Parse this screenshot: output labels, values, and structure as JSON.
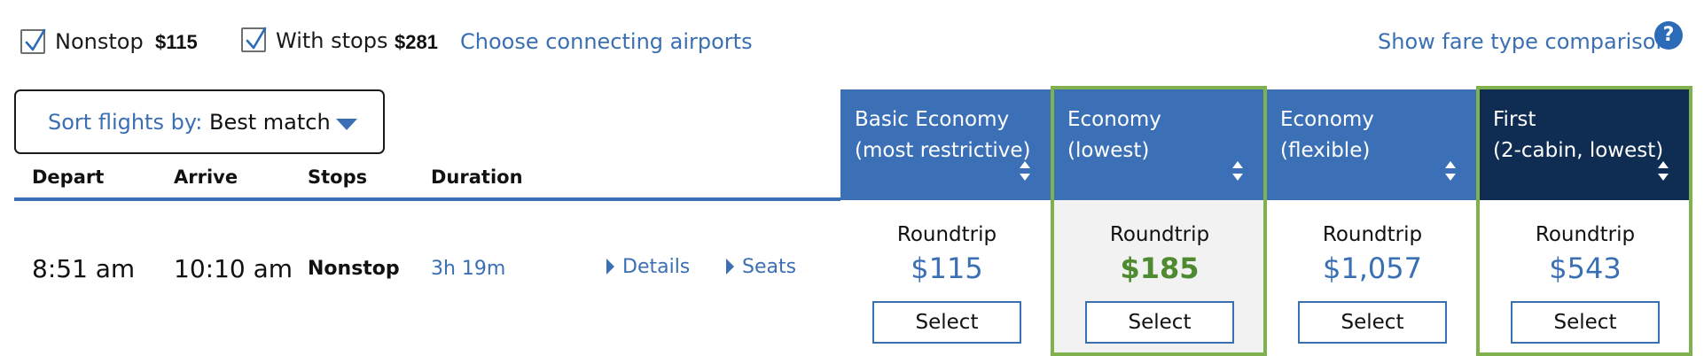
{
  "filters": {
    "nonstop": {
      "label": "Nonstop",
      "price": "$115",
      "checked": true
    },
    "with_stops": {
      "label": "With stops",
      "price": "$281",
      "checked": true
    },
    "connecting_link": "Choose connecting airports",
    "fare_comparison_link": "Show fare type comparison",
    "help_icon": "?"
  },
  "sort": {
    "prefix": "Sort flights by:",
    "value": "Best match",
    "icon": "caret-down-icon"
  },
  "columns": [
    "Depart",
    "Arrive",
    "Stops",
    "Duration"
  ],
  "fare_types": [
    {
      "line1": "Basic Economy",
      "line2": "(most restrictive)",
      "highlighted": false,
      "dark": false
    },
    {
      "line1": "Economy",
      "line2": "(lowest)",
      "highlighted": true,
      "dark": false
    },
    {
      "line1": "Economy",
      "line2": "(flexible)",
      "highlighted": false,
      "dark": false
    },
    {
      "line1": "First",
      "line2": "(2-cabin, lowest)",
      "highlighted": true,
      "dark": true
    }
  ],
  "flight": {
    "depart": "8:51 am",
    "arrive": "10:10 am",
    "stops": "Nonstop",
    "duration": "3h 19m",
    "details_link": "Details",
    "seats_link": "Seats",
    "fares": [
      {
        "label": "Roundtrip",
        "price": "$115",
        "button": "Select"
      },
      {
        "label": "Roundtrip",
        "price": "$185",
        "button": "Select",
        "best": true
      },
      {
        "label": "Roundtrip",
        "price": "$1,057",
        "button": "Select"
      },
      {
        "label": "Roundtrip",
        "price": "$543",
        "button": "Select"
      }
    ]
  },
  "colors": {
    "link": "#3a6fb3",
    "header_blue": "#3b70b7",
    "header_navy": "#0f2d53",
    "highlight_green": "#7fb24e",
    "best_price_green": "#4e8a2f"
  }
}
